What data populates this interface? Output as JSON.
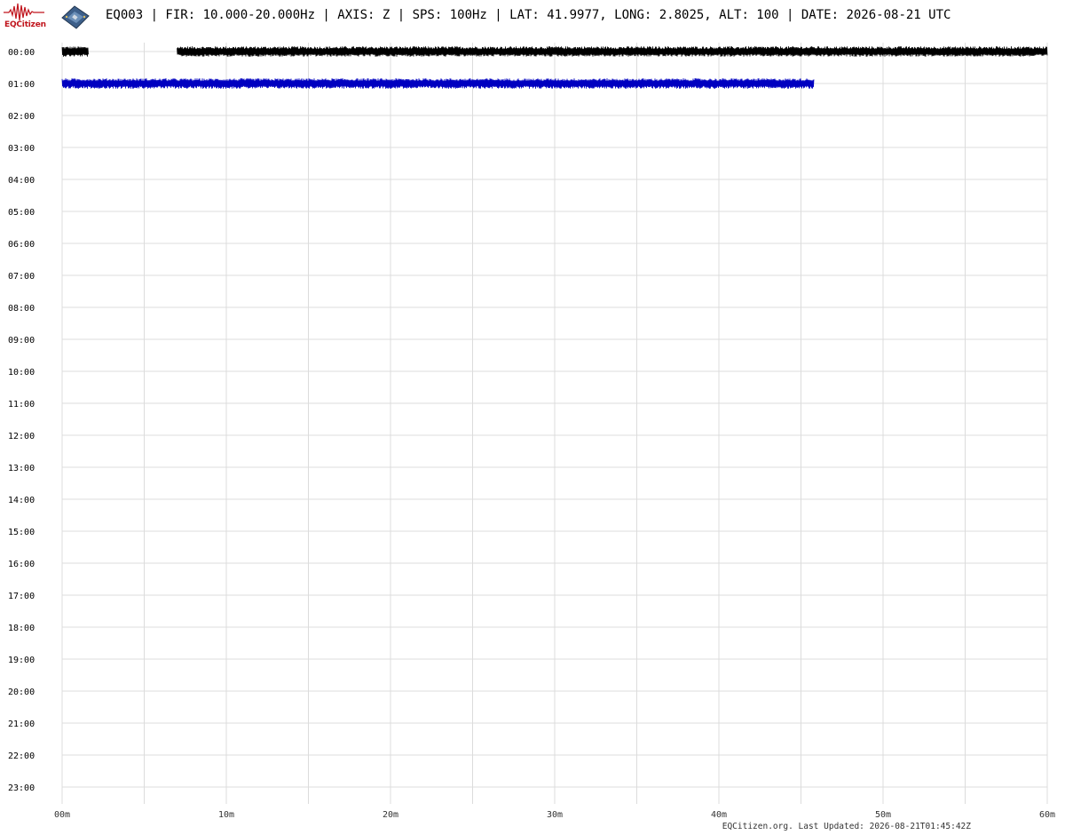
{
  "header": {
    "logo_text": "EQCitizen",
    "title": "EQ003 | FIR: 10.000-20.000Hz | AXIS: Z | SPS: 100Hz | LAT: 41.9977, LONG: 2.8025, ALT: 100 | DATE: 2026-08-21 UTC"
  },
  "footer": {
    "updated": "EQCitizen.org. Last Updated: 2026-08-21T01:45:42Z"
  },
  "chart_data": {
    "type": "line",
    "title": "EQ003 | FIR: 10.000-20.000Hz | AXIS: Z | SPS: 100Hz | LAT: 41.9977, LONG: 2.8025, ALT: 100 | DATE: 2026-08-21 UTC",
    "xlabel": "",
    "ylabel": "",
    "x_unit": "minutes",
    "xlim": [
      0,
      60
    ],
    "x_ticks": [
      "00m",
      "10m",
      "20m",
      "30m",
      "40m",
      "50m",
      "60m"
    ],
    "x_grid_step_minutes": 5,
    "y_rows": [
      "00:00",
      "01:00",
      "02:00",
      "03:00",
      "04:00",
      "05:00",
      "06:00",
      "07:00",
      "08:00",
      "09:00",
      "10:00",
      "11:00",
      "12:00",
      "13:00",
      "14:00",
      "15:00",
      "16:00",
      "17:00",
      "18:00",
      "19:00",
      "20:00",
      "21:00",
      "22:00",
      "23:00"
    ],
    "grid": true,
    "series": [
      {
        "row": "00:00",
        "color": "#000000",
        "segments": [
          [
            0.0,
            1.6
          ],
          [
            7.0,
            60.0
          ]
        ]
      },
      {
        "row": "01:00",
        "color": "#0000c0",
        "segments": [
          [
            0.0,
            45.8
          ]
        ]
      }
    ]
  }
}
